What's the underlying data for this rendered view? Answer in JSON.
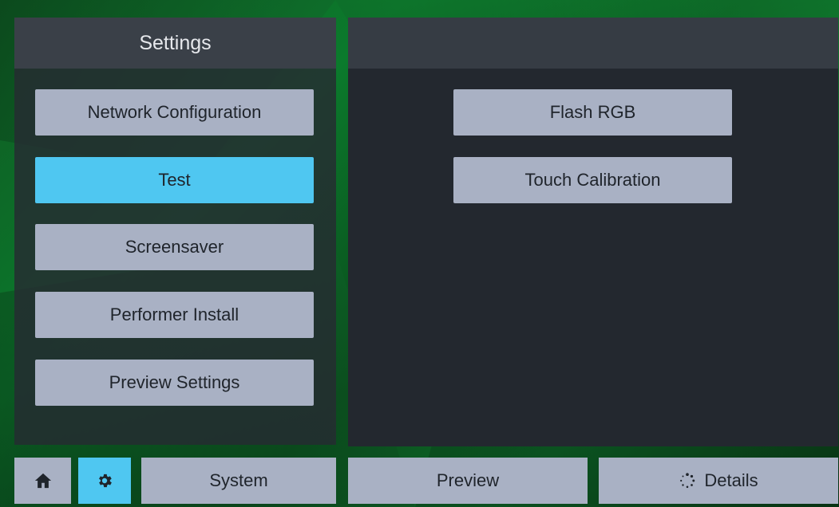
{
  "left_panel": {
    "title": "Settings",
    "menu": [
      {
        "label": "Network Configuration",
        "active": false
      },
      {
        "label": "Test",
        "active": true
      },
      {
        "label": "Screensaver",
        "active": false
      },
      {
        "label": "Performer Install",
        "active": false
      },
      {
        "label": "Preview Settings",
        "active": false
      }
    ]
  },
  "right_panel": {
    "title": "",
    "actions": [
      {
        "label": "Flash RGB"
      },
      {
        "label": "Touch Calibration"
      }
    ]
  },
  "bottom_bar": {
    "home_icon": "home-icon",
    "settings_icon": "gear-icon",
    "system_label": "System",
    "preview_label": "Preview",
    "details_label": "Details",
    "details_icon": "spinner-dots-icon"
  },
  "colors": {
    "accent": "#4fc7f1",
    "button": "#a9b1c4",
    "panel": "#23282f",
    "header": "#3a4048"
  }
}
